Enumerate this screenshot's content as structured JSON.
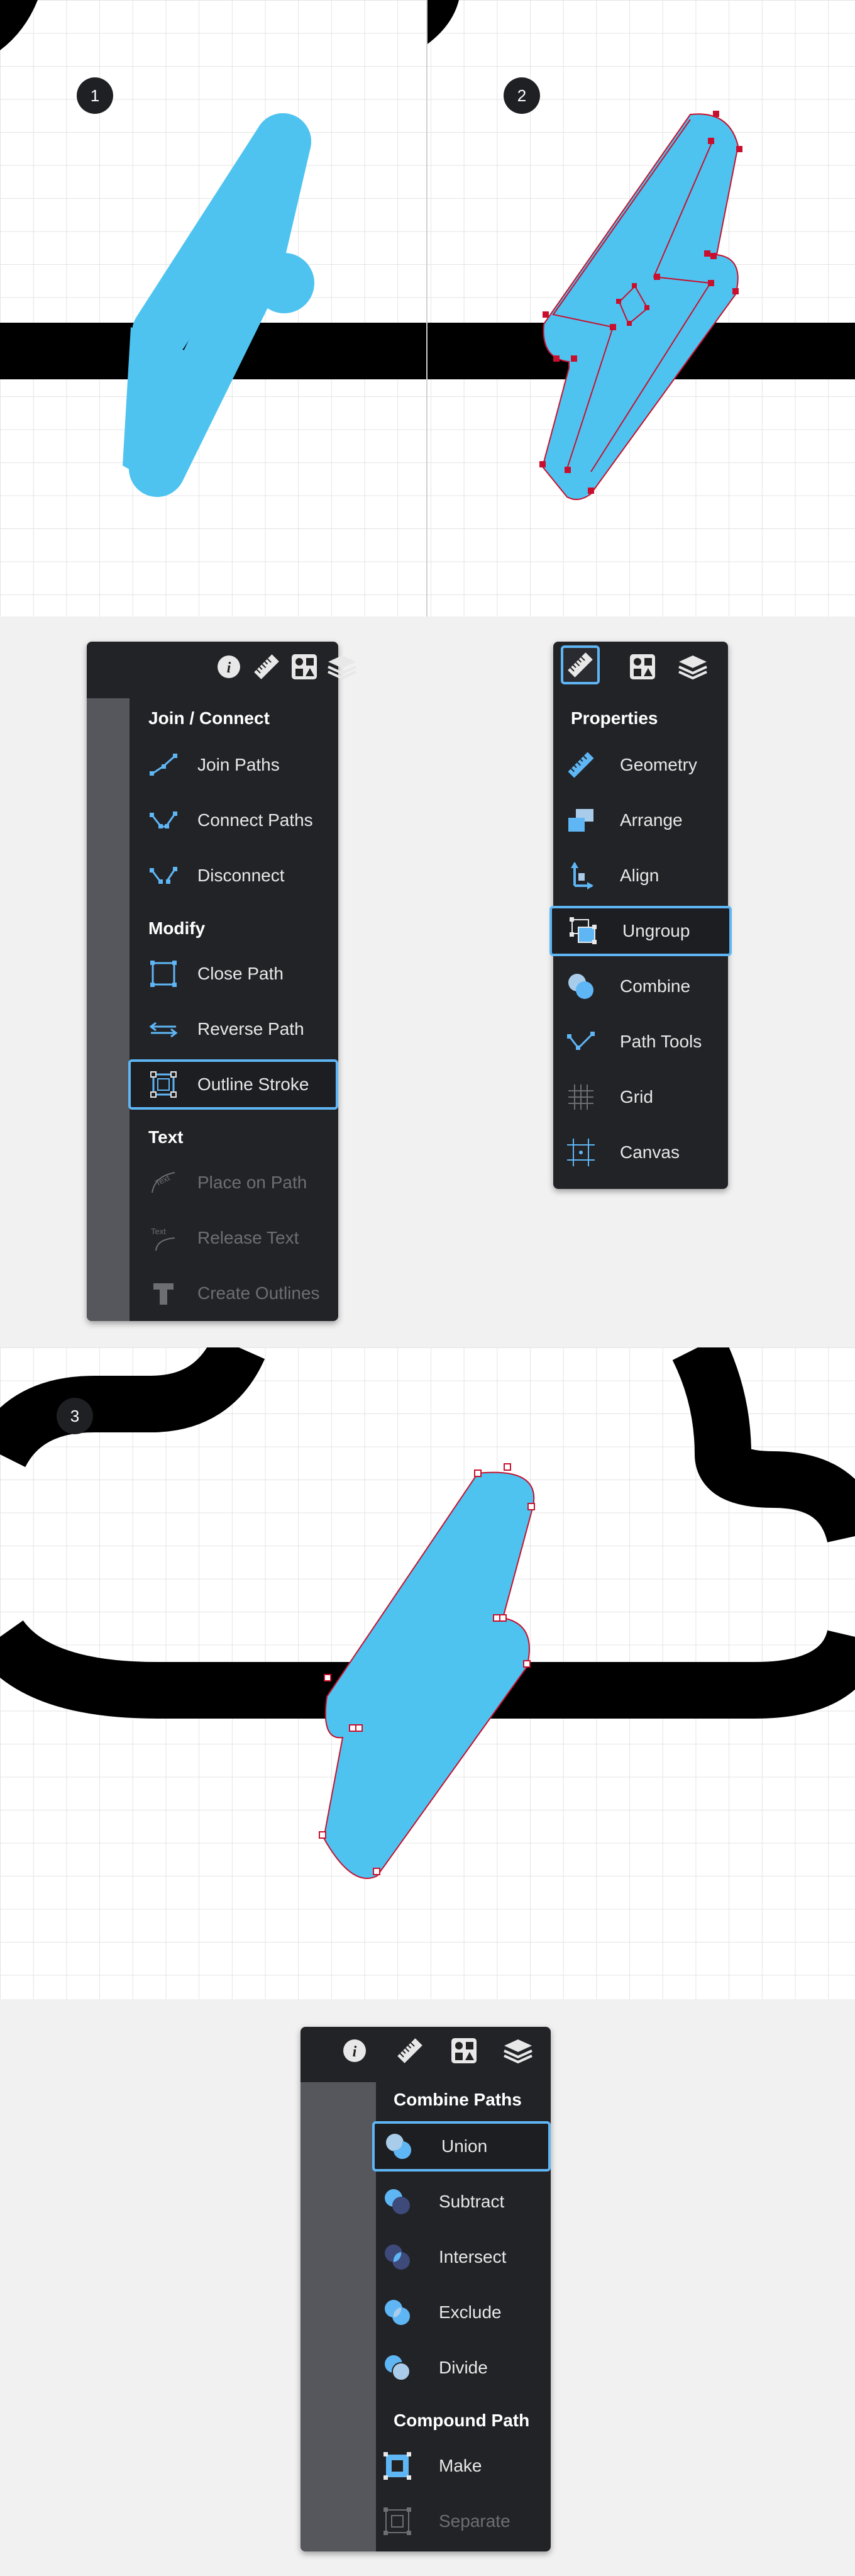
{
  "steps": {
    "step1": "1",
    "step2": "2",
    "step3": "3"
  },
  "colors": {
    "bolt": "#4ec3f0",
    "path_stroke": "#c8102e",
    "accent": "#5fb6f5",
    "panel_bg": "#222327"
  },
  "panel1": {
    "tabs": [
      "info-icon",
      "ruler-icon",
      "shapes-icon",
      "layers-icon"
    ],
    "sections": {
      "join": "Join / Connect",
      "modify": "Modify",
      "text": "Text"
    },
    "items": {
      "join_paths": "Join Paths",
      "connect_paths": "Connect Paths",
      "disconnect": "Disconnect",
      "close_path": "Close Path",
      "reverse_path": "Reverse Path",
      "outline_stroke": "Outline Stroke",
      "place_on_path": "Place on Path",
      "release_text": "Release Text",
      "create_outlines": "Create Outlines"
    },
    "selected": "Outline Stroke"
  },
  "panel2": {
    "tabs": [
      "ruler-icon",
      "shapes-icon",
      "layers-icon"
    ],
    "section": "Properties",
    "items": {
      "geometry": "Geometry",
      "arrange": "Arrange",
      "align": "Align",
      "ungroup": "Ungroup",
      "combine": "Combine",
      "path_tools": "Path Tools",
      "grid": "Grid",
      "canvas": "Canvas"
    },
    "selected": "Ungroup"
  },
  "panel3": {
    "tabs": [
      "info-icon",
      "ruler-icon",
      "shapes-icon",
      "layers-icon"
    ],
    "sections": {
      "combine": "Combine Paths",
      "compound": "Compound Path"
    },
    "items": {
      "union": "Union",
      "subtract": "Subtract",
      "intersect": "Intersect",
      "exclude": "Exclude",
      "divide": "Divide",
      "make": "Make",
      "separate": "Separate"
    },
    "selected": "Union"
  }
}
